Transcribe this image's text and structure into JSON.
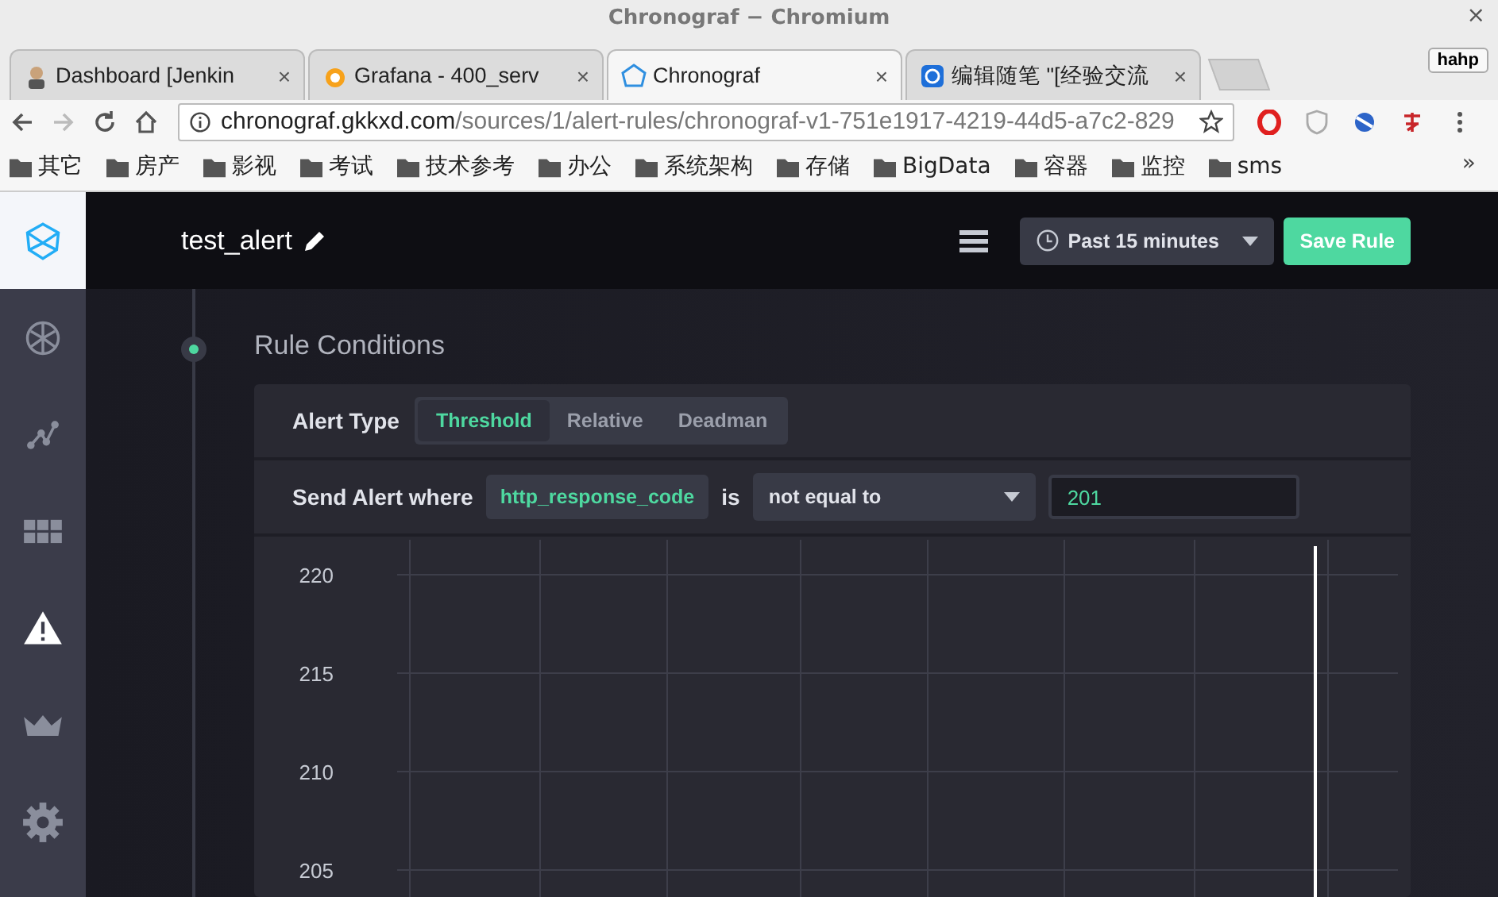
{
  "window": {
    "title": "Chronograf − Chromium",
    "close": "×"
  },
  "tabs": [
    {
      "label": "Dashboard [Jenkin",
      "kind": "person",
      "selected": false,
      "close": "×"
    },
    {
      "label": "Grafana - 400_serv",
      "kind": "grafana",
      "selected": false,
      "close": "×"
    },
    {
      "label": "Chronograf",
      "kind": "chronograf",
      "selected": true,
      "close": "×"
    },
    {
      "label": "编辑随笔 \"[经验交流",
      "kind": "blog",
      "selected": false,
      "close": "×"
    }
  ],
  "profile": "hahp",
  "address": {
    "host": "chronograf.gkkxd.com",
    "path": "/sources/1/alert-rules/chronograf-v1-751e1917-4219-44d5-a7c2-829"
  },
  "bookmarks": [
    "其它",
    "房产",
    "影视",
    "考试",
    "技术参考",
    "办公",
    "系统架构",
    "存储",
    "BigData",
    "容器",
    "监控",
    "sms"
  ],
  "bookmarks_more": "»",
  "sidebar": {
    "items": [
      {
        "kind": "logo",
        "selected": true
      },
      {
        "kind": "hosts",
        "selected": false
      },
      {
        "kind": "graph",
        "selected": false
      },
      {
        "kind": "dashboards",
        "selected": false
      },
      {
        "kind": "alerts",
        "selected": true
      },
      {
        "kind": "admin",
        "selected": false
      },
      {
        "kind": "settings",
        "selected": false
      }
    ]
  },
  "header": {
    "title": "test_alert",
    "time_range": "Past 15 minutes",
    "save": "Save Rule"
  },
  "section": {
    "title": "Rule Conditions"
  },
  "alert_type": {
    "label": "Alert Type",
    "options": [
      {
        "label": "Threshold",
        "selected": true
      },
      {
        "label": "Relative",
        "selected": false
      },
      {
        "label": "Deadman",
        "selected": false
      }
    ]
  },
  "condition": {
    "label": "Send Alert where",
    "field": "http_response_code",
    "verb": "is",
    "operator": "not equal to",
    "value": "201"
  },
  "chart": {
    "y_labels": [
      "220",
      "215",
      "210",
      "205"
    ]
  }
}
